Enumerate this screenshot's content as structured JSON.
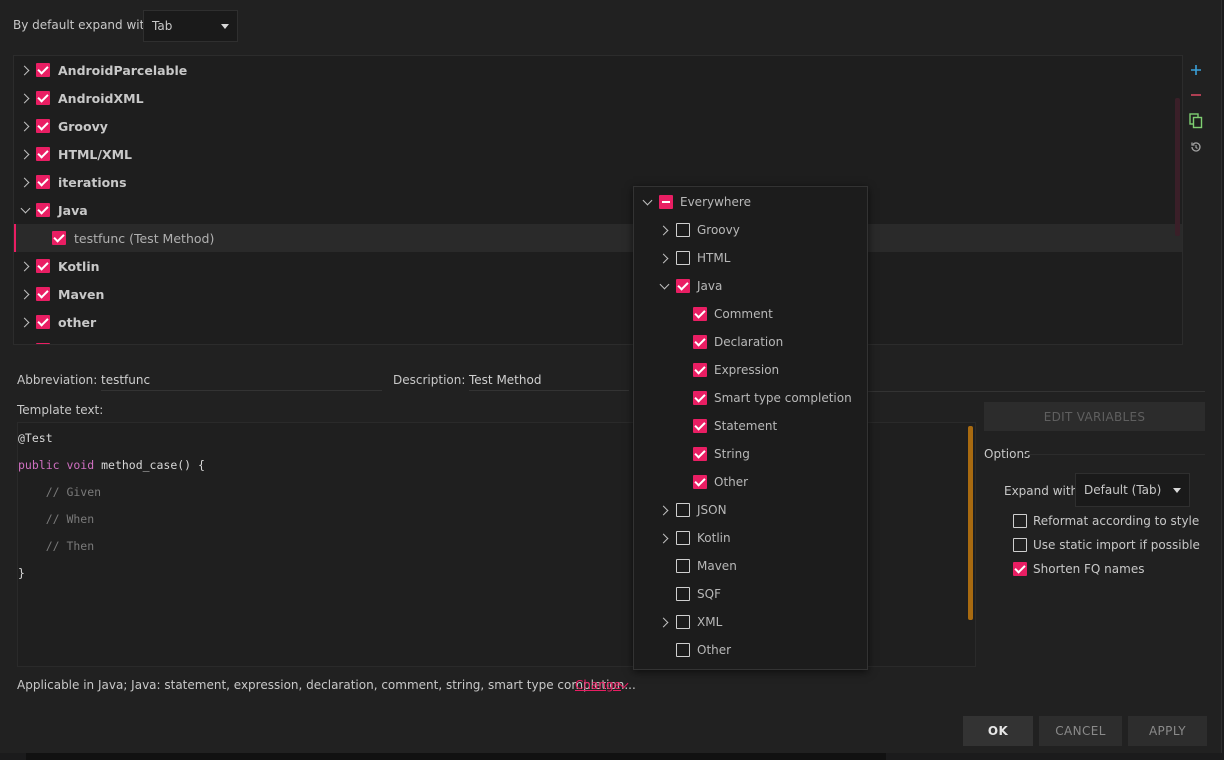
{
  "top": {
    "expand_label": "By default expand with",
    "expand_value": "Tab"
  },
  "tree": {
    "groups": [
      {
        "label": "AndroidParcelable",
        "checked": true,
        "expanded": false
      },
      {
        "label": "AndroidXML",
        "checked": true,
        "expanded": false
      },
      {
        "label": "Groovy",
        "checked": true,
        "expanded": false
      },
      {
        "label": "HTML/XML",
        "checked": true,
        "expanded": false
      },
      {
        "label": "iterations",
        "checked": true,
        "expanded": false
      },
      {
        "label": "Java",
        "checked": true,
        "expanded": true
      },
      {
        "label": "testfunc (Test Method)",
        "checked": true,
        "child": true,
        "selected": true
      },
      {
        "label": "Kotlin",
        "checked": true,
        "expanded": false
      },
      {
        "label": "Maven",
        "checked": true,
        "expanded": false
      },
      {
        "label": "other",
        "checked": true,
        "expanded": false
      }
    ]
  },
  "side_tools": [
    "add-icon",
    "remove-icon",
    "copy-icon",
    "restore-icon"
  ],
  "fields": {
    "abbreviation_label": "Abbreviation:",
    "abbreviation_value": "testfunc",
    "description_label": "Description:",
    "description_value": "Test Method",
    "template_label": "Template text:"
  },
  "template_code": [
    "@Test",
    "public void method_case() {",
    "    // Given",
    "    // When",
    "    // Then",
    "}"
  ],
  "right_panel": {
    "edit_variables": "EDIT VARIABLES",
    "options_title": "Options",
    "expand_with_label": "Expand with",
    "expand_with_value": "Default (Tab)",
    "reformat": "Reformat according to style",
    "static_import": "Use static import if possible",
    "shorten_fq": "Shorten FQ names",
    "reformat_checked": false,
    "static_import_checked": false,
    "shorten_fq_checked": true
  },
  "applicable": {
    "text": "Applicable in Java; Java: statement, expression, declaration, comment, string, smart type completion...",
    "change": "Change"
  },
  "footer": {
    "ok": "OK",
    "cancel": "CANCEL",
    "apply": "APPLY"
  },
  "popup": {
    "items": [
      {
        "label": "Everywhere",
        "state": "partial",
        "expander": "down",
        "level": 0
      },
      {
        "label": "Groovy",
        "state": "off",
        "expander": "right",
        "level": 1
      },
      {
        "label": "HTML",
        "state": "off",
        "expander": "right",
        "level": 1
      },
      {
        "label": "Java",
        "state": "on",
        "expander": "down",
        "level": 1
      },
      {
        "label": "Comment",
        "state": "on",
        "expander": "none",
        "level": 2
      },
      {
        "label": "Declaration",
        "state": "on",
        "expander": "none",
        "level": 2
      },
      {
        "label": "Expression",
        "state": "on",
        "expander": "none",
        "level": 2
      },
      {
        "label": "Smart type completion",
        "state": "on",
        "expander": "none",
        "level": 2
      },
      {
        "label": "Statement",
        "state": "on",
        "expander": "none",
        "level": 2
      },
      {
        "label": "String",
        "state": "on",
        "expander": "none",
        "level": 2
      },
      {
        "label": "Other",
        "state": "on",
        "expander": "none",
        "level": 2
      },
      {
        "label": "JSON",
        "state": "off",
        "expander": "right",
        "level": 1
      },
      {
        "label": "Kotlin",
        "state": "off",
        "expander": "right",
        "level": 1
      },
      {
        "label": "Maven",
        "state": "off",
        "expander": "none",
        "level": 1
      },
      {
        "label": "SQF",
        "state": "off",
        "expander": "none",
        "level": 1
      },
      {
        "label": "XML",
        "state": "off",
        "expander": "right",
        "level": 1
      },
      {
        "label": "Other",
        "state": "off",
        "expander": "none",
        "level": 1
      }
    ]
  },
  "colors": {
    "accent": "#e91e63",
    "background": "#212121",
    "scroll_accent": "#a86a10"
  }
}
